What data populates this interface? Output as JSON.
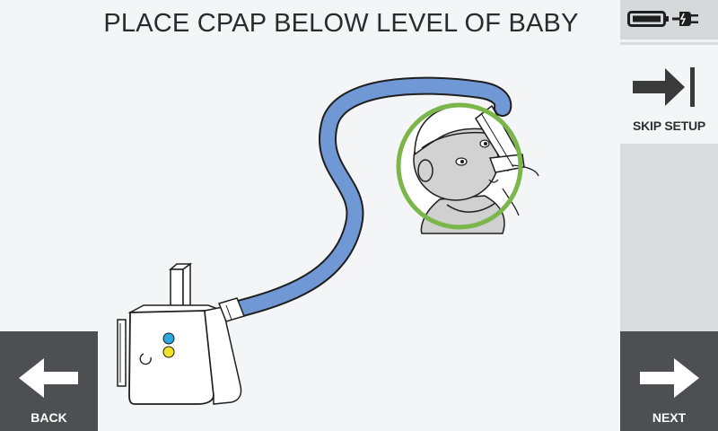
{
  "screen": {
    "title": "PLACE CPAP BELOW LEVEL OF BABY"
  },
  "status": {
    "battery_icon": "battery-full-icon",
    "power_icon": "power-plug-icon"
  },
  "actions": {
    "skip_label": "SKIP SETUP",
    "back_label": "BACK",
    "next_label": "NEXT"
  },
  "colors": {
    "tube": "#7098d4",
    "highlight_ring": "#7ab64a",
    "button_dark": "#4e4f52",
    "indicator_blue": "#2aa8e0",
    "indicator_yellow": "#f2e22a"
  }
}
